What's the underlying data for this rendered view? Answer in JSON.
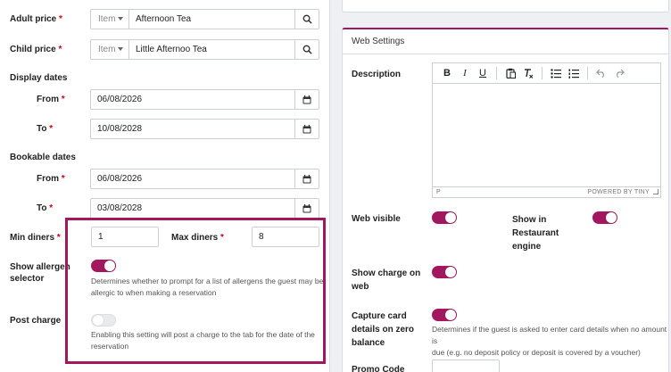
{
  "form": {
    "adult_price": {
      "label": "Adult price",
      "required": "*",
      "type_label": "Item",
      "value": "Afternoon Tea"
    },
    "child_price": {
      "label": "Child price",
      "required": "*",
      "type_label": "Item",
      "value": "Little Afternoo Tea"
    },
    "display_dates": {
      "heading": "Display dates",
      "from": {
        "label": "From",
        "required": "*",
        "value": "06/08/2026"
      },
      "to": {
        "label": "To",
        "required": "*",
        "value": "10/08/2028"
      }
    },
    "bookable_dates": {
      "heading": "Bookable dates",
      "from": {
        "label": "From",
        "required": "*",
        "value": "06/08/2026"
      },
      "to": {
        "label": "To",
        "required": "*",
        "value": "03/08/2028"
      }
    },
    "min_diners": {
      "label": "Min diners",
      "required": "*",
      "value": "1"
    },
    "max_diners": {
      "label": "Max diners",
      "required": "*",
      "value": "8"
    },
    "show_allergen": {
      "label_line1": "Show allergen",
      "label_line2": "selector",
      "enabled": true,
      "help_line1": "Determines whether to prompt for a list of allergens the guest may be",
      "help_line2": "allergic to when making a reservation"
    },
    "post_charge": {
      "label": "Post charge",
      "enabled": false,
      "help_line1": "Enabling this setting will post a charge to the tab for the date of the",
      "help_line2": "reservation"
    }
  },
  "web_settings": {
    "title": "Web Settings",
    "description_label": "Description",
    "editor": {
      "toolbar": [
        "B",
        "I",
        "U",
        "paste",
        "clear-format",
        "bullet-list",
        "numbered-list",
        "undo",
        "redo"
      ],
      "status_path": "P",
      "powered_by": "POWERED BY TINY"
    },
    "web_visible": {
      "label": "Web visible",
      "enabled": true
    },
    "show_in_engine": {
      "label_line1": "Show in",
      "label_line2": "Restaurant",
      "label_line3": "engine",
      "enabled": true
    },
    "show_charge": {
      "label_line1": "Show charge on",
      "label_line2": "web",
      "enabled": true
    },
    "capture_card": {
      "label_line1": "Capture card",
      "label_line2": "details on zero",
      "label_line3": "balance",
      "enabled": true,
      "help_line1": "Determines if the guest is asked to enter card details when no amount is",
      "help_line2": "due (e.g. no deposit policy or deposit is covered by a voucher)"
    },
    "promo_code": {
      "label": "Promo Code",
      "value": ""
    }
  },
  "colors": {
    "accent": "#a3175e",
    "required": "#d0021b",
    "border": "#ccd0d5"
  }
}
